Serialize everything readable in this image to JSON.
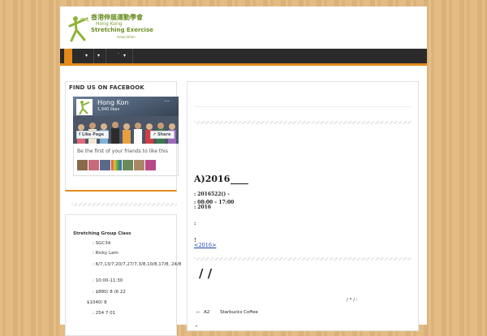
{
  "header": {
    "logo_cn": "香港伸展運動學會",
    "logo_line1": "Hong Kong",
    "logo_line2": "Stretching Exercise",
    "logo_line3": "Association"
  },
  "nav": {
    "arrow": "▾",
    "mini_label": "▾"
  },
  "sidebar": {
    "facebook_title": "Find us on Facebook",
    "fb_page_name": "Hong Kon",
    "fb_likes": "1,940 likes",
    "fb_dots": "···",
    "fb_like_label": "Like Page",
    "fb_share_label": "Share",
    "fb_friends_text": "Be the first of your friends to like this",
    "class_title": "Stretching Group Class",
    "class_code": ": SGC34",
    "class_teacher": ": Ricky Lam",
    "class_dates": ": 6/7,13/7,20/7,27/7,3/8,10/8,17/8, 24/8",
    "class_time": ": 10:00-11:30",
    "class_fee": ": $880/ 8      (6     22",
    "class_fee2": "$1040/ 8",
    "class_venue": ":                   254                   7     01"
  },
  "main": {
    "title_prefix": "A)",
    "title_year": "2016",
    "date_line": ":  2016522() -",
    "time_line": ":  08:00 – 17:00",
    "year_line": ":  2016",
    "colon_line": ":",
    "bang_line": "!",
    "link_text": "<2016>",
    "slashes": "/  /",
    "foot_marks": "/     *           /           :",
    "foot_dash": "—",
    "foot_room": "A2",
    "foot_place": "Starbucks Coffee",
    "foot_bottom": "\""
  },
  "colors": {
    "accent": "#e38a1b",
    "nav_bg": "#2b2b2b",
    "logo_green": "#6b8e23",
    "link": "#1a3fb0"
  }
}
